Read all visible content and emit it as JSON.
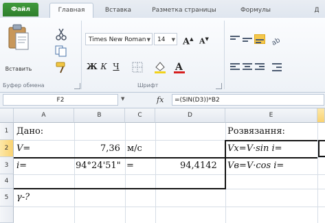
{
  "tabs": {
    "file": "Файл",
    "home": "Главная",
    "insert": "Вставка",
    "page_layout": "Разметка страницы",
    "formulas": "Формулы",
    "extra": "Д"
  },
  "ribbon": {
    "paste_label": "Вставить",
    "clipboard_label": "Буфер обмена",
    "font_label": "Шрифт",
    "font_name": "Times New Roman",
    "font_size": "14",
    "bold": "Ж",
    "italic": "К",
    "underline": "Ч"
  },
  "formula_bar": {
    "name_box": "F2",
    "fx": "fx",
    "formula": "=(SIN(D3))*B2"
  },
  "columns": [
    "A",
    "B",
    "C",
    "D",
    "E"
  ],
  "rows": [
    "1",
    "2",
    "3",
    "4",
    "5"
  ],
  "cells": {
    "a1": "Дано:",
    "e1": "Розвязання:",
    "a2": "V=",
    "b2": "7,36",
    "c2": "м/с",
    "e2": "Vx=V·sin i=",
    "a3": "i=",
    "b3": "94°24'51\"",
    "c3": "=",
    "d3": "94,4142",
    "e3": "Vв=V·cos i=",
    "a5": "γ-?"
  },
  "colors": {
    "accent": "#f5c84c",
    "file_tab": "#2f7e2c"
  }
}
